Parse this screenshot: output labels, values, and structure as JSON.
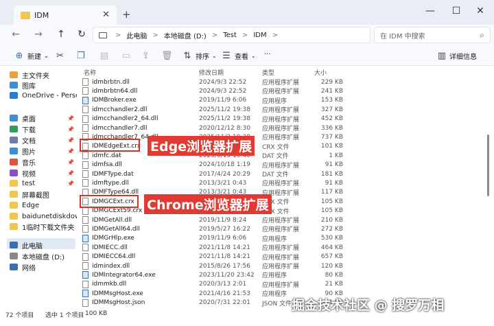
{
  "window": {
    "tab_title": "IDM",
    "tab_close": "✕",
    "new_tab": "+",
    "minimize": "—",
    "maximize": "☐",
    "close": "✕"
  },
  "nav": {
    "back": "←",
    "forward": "→",
    "up": "↑",
    "refresh": "↻",
    "breadcrumbs": [
      "此电脑",
      "本地磁盘 (D:)",
      "Test",
      "IDM"
    ],
    "chevron": ">",
    "search_placeholder": "在 IDM 中搜索"
  },
  "toolbar": {
    "new_label": "新建",
    "sort_label": "排序",
    "view_label": "查看",
    "more": "···",
    "details_label": "详细信息"
  },
  "sidebar": {
    "items": [
      {
        "label": "主文件夹",
        "color": "#e8a23a",
        "pinned": false
      },
      {
        "label": "图库",
        "color": "#3a8fd6",
        "pinned": false
      },
      {
        "label": "OneDrive - Personal",
        "color": "#2b7cd3",
        "pinned": false
      },
      {
        "label": "桌面",
        "color": "#3a8fd6",
        "pinned": true
      },
      {
        "label": "下载",
        "color": "#2f9d5a",
        "pinned": true
      },
      {
        "label": "文档",
        "color": "#6b7fa8",
        "pinned": true
      },
      {
        "label": "图片",
        "color": "#3a8fd6",
        "pinned": true
      },
      {
        "label": "音乐",
        "color": "#e0533c",
        "pinned": true
      },
      {
        "label": "视频",
        "color": "#8a4fc8",
        "pinned": true
      },
      {
        "label": "test",
        "color": "#f2c64d",
        "pinned": true
      },
      {
        "label": "屏幕截图",
        "color": "#f2c64d",
        "pinned": false
      },
      {
        "label": "Edge",
        "color": "#f2c64d",
        "pinned": false
      },
      {
        "label": "baidunetdiskdownload",
        "color": "#f2c64d",
        "pinned": false
      },
      {
        "label": "1临时下载文件夹",
        "color": "#f2c64d",
        "pinned": false
      },
      {
        "label": "此电脑",
        "color": "#3a6fb0",
        "pinned": false
      },
      {
        "label": "本地磁盘 (D:)",
        "color": "#8a8a8a",
        "pinned": false
      },
      {
        "label": "网络",
        "color": "#3a6fb0",
        "pinned": false
      }
    ]
  },
  "columns": {
    "name": "名称",
    "date": "修改日期",
    "type": "类型",
    "size": "大小"
  },
  "files": [
    {
      "name": "idmbrbtn.dll",
      "date": "2024/9/3 22:52",
      "type": "应用程序扩展",
      "size": "229 KB"
    },
    {
      "name": "idmbrbtn64.dll",
      "date": "2024/9/3 22:52",
      "type": "应用程序扩展",
      "size": "241 KB"
    },
    {
      "name": "IDMBroker.exe",
      "date": "2019/11/9 6:06",
      "type": "应用程序",
      "size": "153 KB"
    },
    {
      "name": "idmcchandler2.dll",
      "date": "2025/11/2 19:38",
      "type": "应用程序扩展",
      "size": "327 KB"
    },
    {
      "name": "idmcchandler2_64.dll",
      "date": "2025/11/2 19:38",
      "type": "应用程序扩展",
      "size": "452 KB"
    },
    {
      "name": "idmcchandler7.dll",
      "date": "2020/12/12 8:30",
      "type": "应用程序扩展",
      "size": "336 KB"
    },
    {
      "name": "idmcchandler7_64.dll",
      "date": "2025/11/2 19:38",
      "type": "应用程序扩展",
      "size": "737 KB"
    },
    {
      "name": "IDMEdgeExt.crx",
      "date": "2019/11/9 6:06",
      "type": "CRX 文件",
      "size": "101 KB"
    },
    {
      "name": "idmfc.dat",
      "date": "2023/6/13 10:40",
      "type": "DAT 文件",
      "size": "1 KB"
    },
    {
      "name": "idmfsa.dll",
      "date": "2024/10/18 1:19",
      "type": "应用程序扩展",
      "size": "91 KB"
    },
    {
      "name": "IDMFType.dat",
      "date": "2017/4/24 20:29",
      "type": "DAT 文件",
      "size": "181 KB"
    },
    {
      "name": "idmftype.dll",
      "date": "2013/3/21 0:43",
      "type": "应用程序扩展",
      "size": "91 KB"
    },
    {
      "name": "IDMFType64.dll",
      "date": "2013/3/21 0:43",
      "type": "应用程序扩展",
      "size": "117 KB"
    },
    {
      "name": "IDMGCExt.crx",
      "date": "2019/11/9 6:06",
      "type": "CRX 文件",
      "size": "105 KB"
    },
    {
      "name": "IDMGCExt59.crx",
      "date": "2019/11/9 6:06",
      "type": "CRX 文件",
      "size": "105 KB"
    },
    {
      "name": "IDMGetAll.dll",
      "date": "2019/11/9 8:24",
      "type": "应用程序扩展",
      "size": "210 KB"
    },
    {
      "name": "IDMGetAll64.dll",
      "date": "2019/5/27 16:22",
      "type": "应用程序扩展",
      "size": "272 KB"
    },
    {
      "name": "IDMGrHlp.exe",
      "date": "2019/11/9 6:06",
      "type": "应用程序",
      "size": "530 KB"
    },
    {
      "name": "IDMIECC.dll",
      "date": "2021/11/8 14:21",
      "type": "应用程序扩展",
      "size": "464 KB"
    },
    {
      "name": "IDMIECC64.dll",
      "date": "2021/11/8 14:21",
      "type": "应用程序扩展",
      "size": "657 KB"
    },
    {
      "name": "idmindex.dll",
      "date": "2015/8/26 17:56",
      "type": "应用程序扩展",
      "size": "120 KB"
    },
    {
      "name": "IDMIntegrator64.exe",
      "date": "2023/11/20 23:42",
      "type": "应用程序",
      "size": "80 KB"
    },
    {
      "name": "idmmkb.dll",
      "date": "2020/3/13 2:01",
      "type": "应用程序扩展",
      "size": "21 KB"
    },
    {
      "name": "IDMMsgHost.exe",
      "date": "2021/4/16 21:53",
      "type": "应用程序",
      "size": "90 KB"
    },
    {
      "name": "IDMMsgHost.json",
      "date": "2020/7/31 22:01",
      "type": "JSON 文件",
      "size": "1 KB"
    }
  ],
  "annotations": {
    "edge": "Edge浏览器扩展",
    "chrome": "Chrome浏览器扩展"
  },
  "status": {
    "count": "72 个项目",
    "selected": "选中 1 个项目",
    "size": "100 KB"
  },
  "watermark": "掘金技术社区 @ 搜罗万相"
}
